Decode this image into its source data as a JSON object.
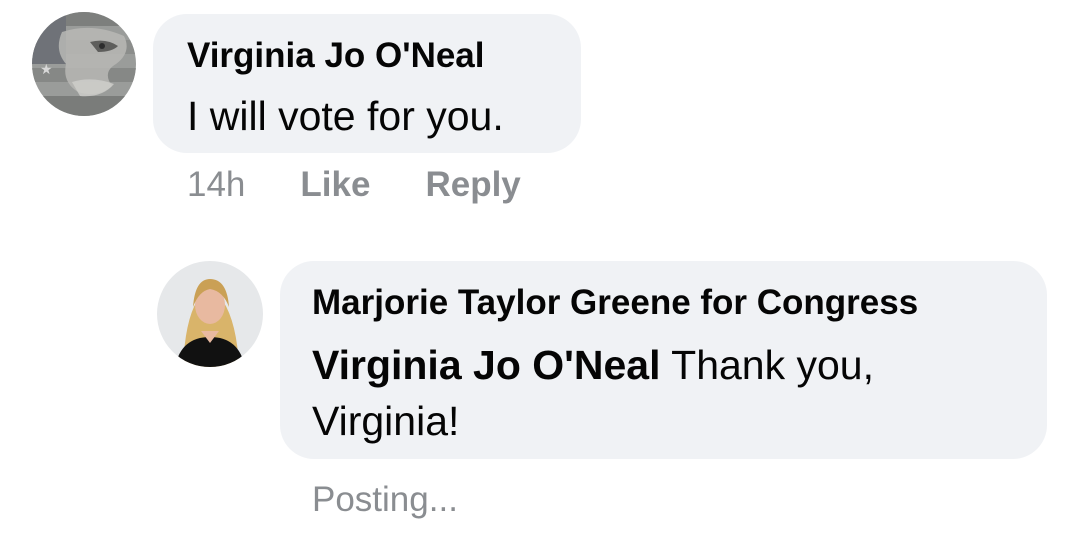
{
  "comment": {
    "author": "Virginia Jo O'Neal",
    "text": "I will vote for you.",
    "timestamp": "14h",
    "like_label": "Like",
    "reply_label": "Reply",
    "avatar_icon": "eagle-flag-avatar"
  },
  "reply": {
    "author": "Marjorie Taylor Greene for Congress",
    "mention": "Virginia Jo O'Neal",
    "text": " Thank you, Virginia!",
    "status": "Posting...",
    "avatar_icon": "profile-photo-avatar"
  },
  "colors": {
    "bubble_bg": "#f0f2f5",
    "secondary_text": "#8a8d91",
    "primary_text": "#050505"
  }
}
